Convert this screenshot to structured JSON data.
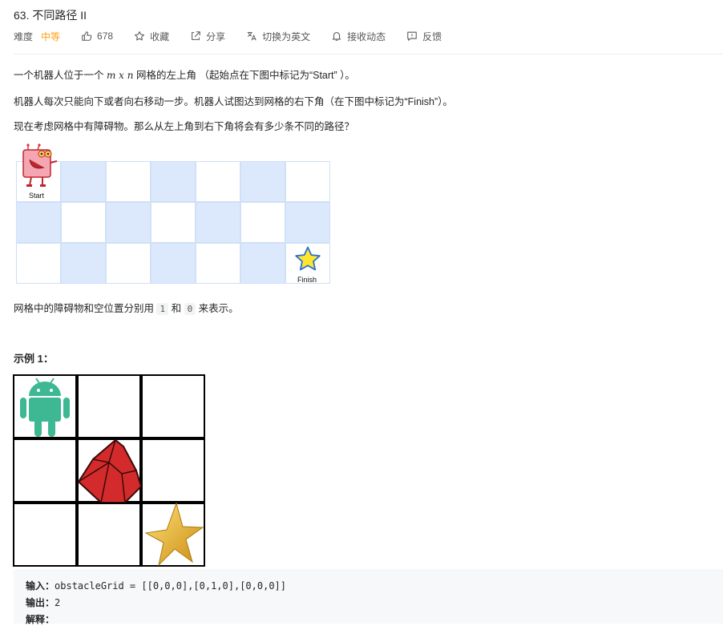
{
  "problem": {
    "title": "63. 不同路径 II",
    "difficulty_label": "难度",
    "difficulty": "中等",
    "likes": "678",
    "actions": [
      "收藏",
      "分享",
      "切换为英文",
      "接收动态",
      "反馈"
    ]
  },
  "description": {
    "p1_before": "一个机器人位于一个 ",
    "p1_dims": "m x n",
    "p1_after": " 网格的左上角 （起始点在下图中标记为“Start” ）。",
    "p2": "机器人每次只能向下或者向右移动一步。机器人试图达到网格的右下角（在下图中标记为“Finish”）。",
    "p3": "现在考虑网格中有障碍物。那么从左上角到右下角将会有多少条不同的路径？",
    "grid_start_label": "Start",
    "grid_finish_label": "Finish",
    "p4_before": "网格中的障碍物和空位置分别用 ",
    "p4_code1": "1",
    "p4_mid": " 和 ",
    "p4_code2": "0",
    "p4_after": " 来表示。"
  },
  "example1": {
    "heading": "示例 1：",
    "input_label": "输入：",
    "input_value": "obstacleGrid = [[0,0,0],[0,1,0],[0,0,0]]",
    "output_label": "输出：",
    "output_value": "2",
    "explain_label": "解释："
  },
  "colors": {
    "accent_difficulty": "#ffa116",
    "grid_blue": "#dce9fd",
    "android_green": "#3db893",
    "ruby_red": "#d32b2b",
    "star_gold": "#f2b92a"
  }
}
